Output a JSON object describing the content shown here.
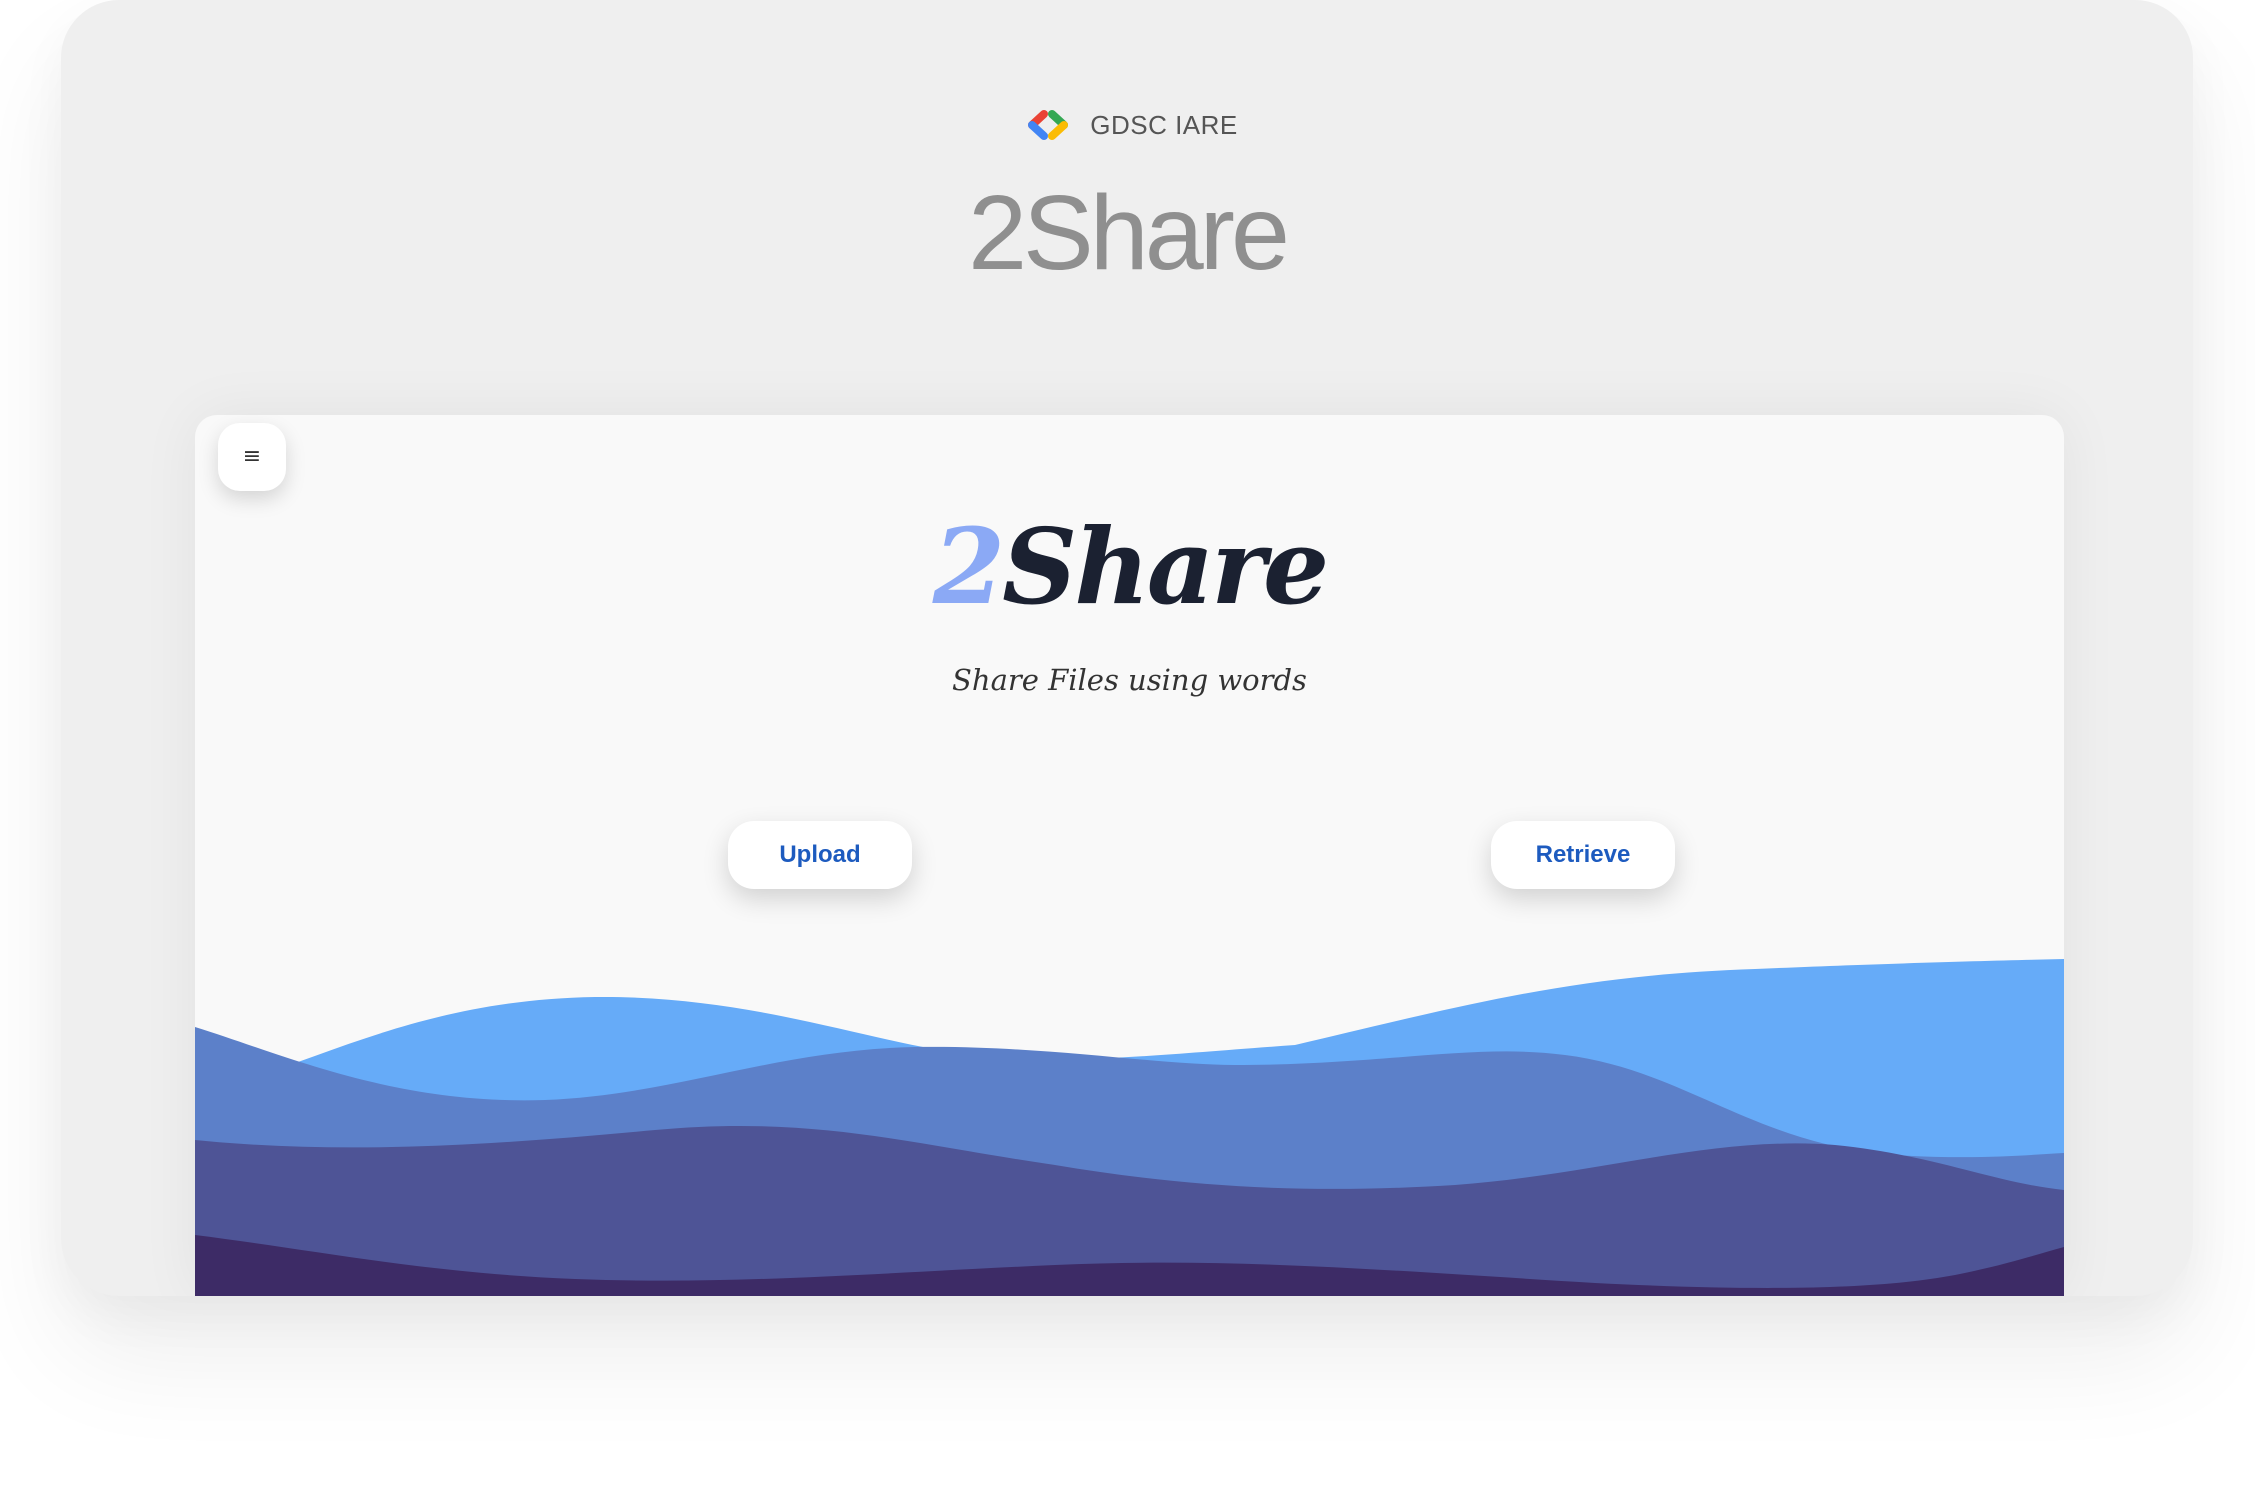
{
  "brand": {
    "name": "GDSC IARE",
    "logo": "gdsc-brackets-logo",
    "colors": [
      "#ea4335",
      "#4285f4",
      "#34a853",
      "#fbbc04"
    ]
  },
  "hero": {
    "title": "2Share"
  },
  "app": {
    "menu_icon": "≡",
    "title_accent": "2",
    "title_rest": "Share",
    "tagline": "Share Files using words",
    "upload_label": "Upload",
    "retrieve_label": "Retrieve",
    "colors": {
      "title": "#1b2131",
      "accent": "#8ba9f5",
      "button_text": "#1d5bbf",
      "wave_light": "#66abf8",
      "wave_mid": "#5c80c9",
      "wave_dark": "#4e5496",
      "wave_deepest": "#3d2b66"
    }
  }
}
